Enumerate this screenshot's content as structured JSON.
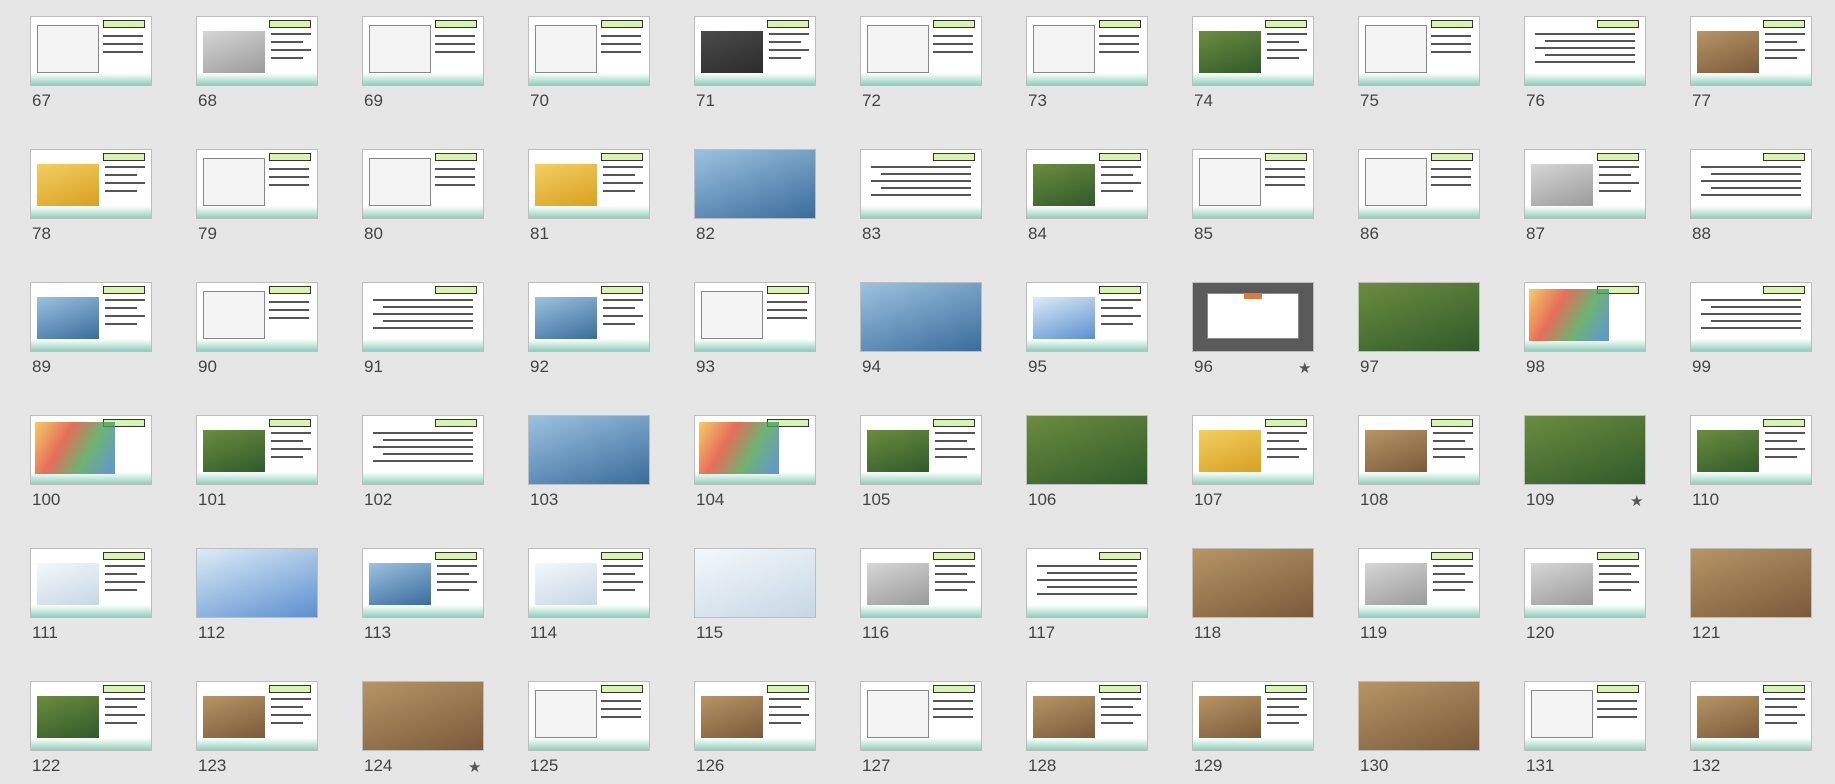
{
  "slides": [
    {
      "n": "67",
      "kind": "diagram"
    },
    {
      "n": "68",
      "kind": "gray"
    },
    {
      "n": "69",
      "kind": "diagram"
    },
    {
      "n": "70",
      "kind": "diagram"
    },
    {
      "n": "71",
      "kind": "dark"
    },
    {
      "n": "72",
      "kind": "diagram"
    },
    {
      "n": "73",
      "kind": "diagram"
    },
    {
      "n": "74",
      "kind": "photo-green"
    },
    {
      "n": "75",
      "kind": "diagram"
    },
    {
      "n": "76",
      "kind": "text"
    },
    {
      "n": "77",
      "kind": "photo-brown"
    },
    {
      "n": "78",
      "kind": "photo-sun"
    },
    {
      "n": "79",
      "kind": "diagram"
    },
    {
      "n": "80",
      "kind": "diagram"
    },
    {
      "n": "81",
      "kind": "photo-sun"
    },
    {
      "n": "82",
      "kind": "photo-blue"
    },
    {
      "n": "83",
      "kind": "text"
    },
    {
      "n": "84",
      "kind": "photo-green"
    },
    {
      "n": "85",
      "kind": "diagram"
    },
    {
      "n": "86",
      "kind": "diagram"
    },
    {
      "n": "87",
      "kind": "gray"
    },
    {
      "n": "88",
      "kind": "text"
    },
    {
      "n": "89",
      "kind": "photo-blue"
    },
    {
      "n": "90",
      "kind": "diagram"
    },
    {
      "n": "91",
      "kind": "text"
    },
    {
      "n": "92",
      "kind": "photo-blue"
    },
    {
      "n": "93",
      "kind": "diagram"
    },
    {
      "n": "94",
      "kind": "photo-blue"
    },
    {
      "n": "95",
      "kind": "photo-sky"
    },
    {
      "n": "96",
      "kind": "section",
      "star": "★"
    },
    {
      "n": "97",
      "kind": "photo-green"
    },
    {
      "n": "98",
      "kind": "map"
    },
    {
      "n": "99",
      "kind": "text"
    },
    {
      "n": "100",
      "kind": "map"
    },
    {
      "n": "101",
      "kind": "photo-green"
    },
    {
      "n": "102",
      "kind": "text"
    },
    {
      "n": "103",
      "kind": "photo-blue"
    },
    {
      "n": "104",
      "kind": "map"
    },
    {
      "n": "105",
      "kind": "photo-green"
    },
    {
      "n": "106",
      "kind": "photo-green"
    },
    {
      "n": "107",
      "kind": "photo-sun"
    },
    {
      "n": "108",
      "kind": "photo-brown"
    },
    {
      "n": "109",
      "kind": "photo-green",
      "star": "★"
    },
    {
      "n": "110",
      "kind": "photo-green"
    },
    {
      "n": "111",
      "kind": "photo-snow"
    },
    {
      "n": "112",
      "kind": "photo-sky"
    },
    {
      "n": "113",
      "kind": "photo-blue"
    },
    {
      "n": "114",
      "kind": "photo-snow"
    },
    {
      "n": "115",
      "kind": "photo-snow"
    },
    {
      "n": "116",
      "kind": "gray"
    },
    {
      "n": "117",
      "kind": "text"
    },
    {
      "n": "118",
      "kind": "photo-brown"
    },
    {
      "n": "119",
      "kind": "gray"
    },
    {
      "n": "120",
      "kind": "gray"
    },
    {
      "n": "121",
      "kind": "photo-brown"
    },
    {
      "n": "122",
      "kind": "photo-green"
    },
    {
      "n": "123",
      "kind": "photo-brown"
    },
    {
      "n": "124",
      "kind": "photo-brown",
      "star": "★"
    },
    {
      "n": "125",
      "kind": "diagram"
    },
    {
      "n": "126",
      "kind": "photo-brown"
    },
    {
      "n": "127",
      "kind": "diagram"
    },
    {
      "n": "128",
      "kind": "photo-brown"
    },
    {
      "n": "129",
      "kind": "photo-brown"
    },
    {
      "n": "130",
      "kind": "photo-brown"
    },
    {
      "n": "131",
      "kind": "diagram"
    },
    {
      "n": "132",
      "kind": "photo-brown"
    }
  ]
}
